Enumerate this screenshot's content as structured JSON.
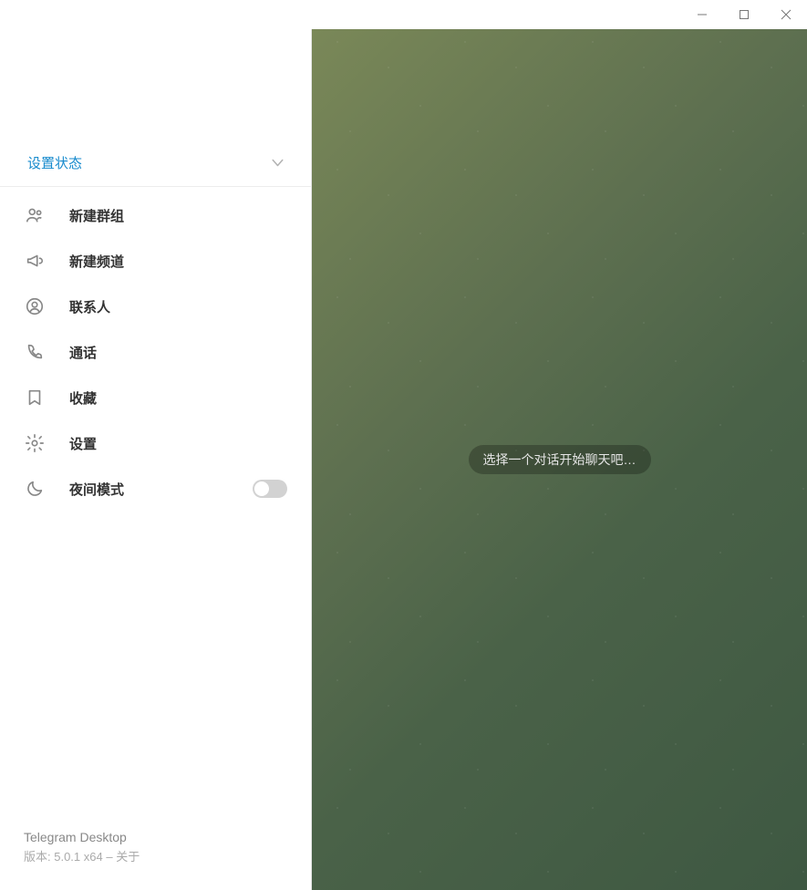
{
  "status": {
    "set_status_label": "设置状态"
  },
  "menu": {
    "new_group": "新建群组",
    "new_channel": "新建频道",
    "contacts": "联系人",
    "calls": "通话",
    "saved": "收藏",
    "settings": "设置",
    "night_mode": "夜间模式"
  },
  "footer": {
    "app_name": "Telegram Desktop",
    "version_prefix": "版本: ",
    "version_value": "5.0.1 x64",
    "separator": " – ",
    "about_label": "关于"
  },
  "content": {
    "empty_hint": "选择一个对话开始聊天吧…"
  }
}
